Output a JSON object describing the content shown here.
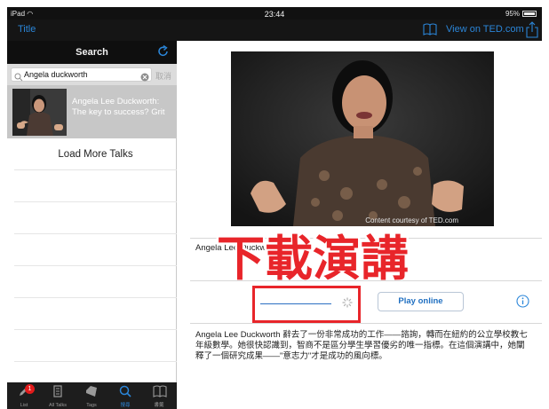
{
  "status_bar": {
    "device": "iPad",
    "time": "23:44",
    "battery": "95%",
    "battery_level": 0.95
  },
  "nav_bar": {
    "title": "Title",
    "view_on_ted": "View on TED.com",
    "icons": [
      "book-icon",
      "share-icon"
    ]
  },
  "search_panel": {
    "header": "Search",
    "query": "Angela duckworth",
    "cancel": "取消",
    "results": [
      {
        "title": "Angela Lee Duckworth: The key to success? Grit"
      }
    ],
    "load_more": "Load More Talks"
  },
  "tab_bar": {
    "tabs": [
      {
        "label": "List",
        "icon": "edit-icon",
        "badge": "1"
      },
      {
        "label": "All Talks",
        "icon": "talks-icon"
      },
      {
        "label": "Tags",
        "icon": "tag-icon"
      },
      {
        "label": "搜尋",
        "icon": "search-icon",
        "active": true
      },
      {
        "label": "書籤",
        "icon": "book-icon"
      }
    ]
  },
  "detail": {
    "video_caption": "Content courtesy of TED.com",
    "speaker": "Angela Lee Duckworth",
    "overlay_text": "下載演講",
    "play_online": "Play online",
    "description": "Angela Lee Duckworth 辭去了一份非常成功的工作——諮詢，轉而在紐約的公立學校教七年級數學。她很快認識到，智商不是區分學生學習優劣的唯一指標。在這個演講中，她闡釋了一個研究成果——\"意志力\"才是成功的風向標。"
  },
  "colors": {
    "accent": "#2b86d9",
    "highlight": "#e8252a",
    "bar_bg": "#111111"
  }
}
